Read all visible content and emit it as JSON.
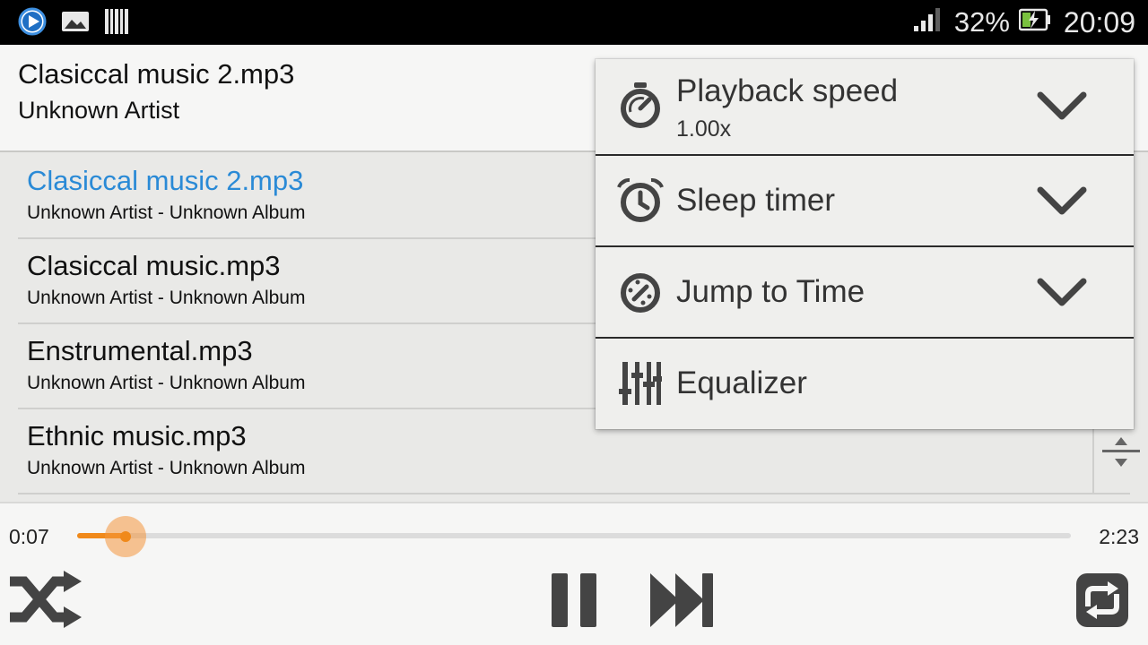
{
  "status_bar": {
    "battery_percent": "32%",
    "time": "20:09",
    "icons": [
      "play-notification-icon",
      "image-notification-icon",
      "barcode-notification-icon",
      "signal-icon",
      "battery-charging-icon"
    ]
  },
  "now_playing": {
    "title": "Clasiccal music 2.mp3",
    "artist": "Unknown Artist"
  },
  "playlist": {
    "tracks": [
      {
        "name": "Clasiccal music 2.mp3",
        "subtitle": "Unknown Artist - Unknown Album",
        "active": true
      },
      {
        "name": "Clasiccal music.mp3",
        "subtitle": "Unknown Artist - Unknown Album",
        "active": false
      },
      {
        "name": "Enstrumental.mp3",
        "subtitle": "Unknown Artist - Unknown Album",
        "active": false
      },
      {
        "name": "Ethnic music.mp3",
        "subtitle": "Unknown Artist - Unknown Album",
        "active": false
      }
    ]
  },
  "player": {
    "elapsed": "0:07",
    "total": "2:23",
    "progress_fraction": 0.049,
    "accent_color": "#f0891a"
  },
  "menu": {
    "items": [
      {
        "label": "Playback speed",
        "value": "1.00x",
        "icon": "stopwatch-icon",
        "has_dropdown": true
      },
      {
        "label": "Sleep timer",
        "icon": "alarm-clock-icon",
        "has_dropdown": true
      },
      {
        "label": "Jump to Time",
        "icon": "speedometer-icon",
        "has_dropdown": true
      },
      {
        "label": "Equalizer",
        "icon": "equalizer-icon",
        "has_dropdown": false
      }
    ]
  },
  "colors": {
    "active_track": "#2a8ad6",
    "accent": "#f0891a",
    "icon": "#444444"
  }
}
